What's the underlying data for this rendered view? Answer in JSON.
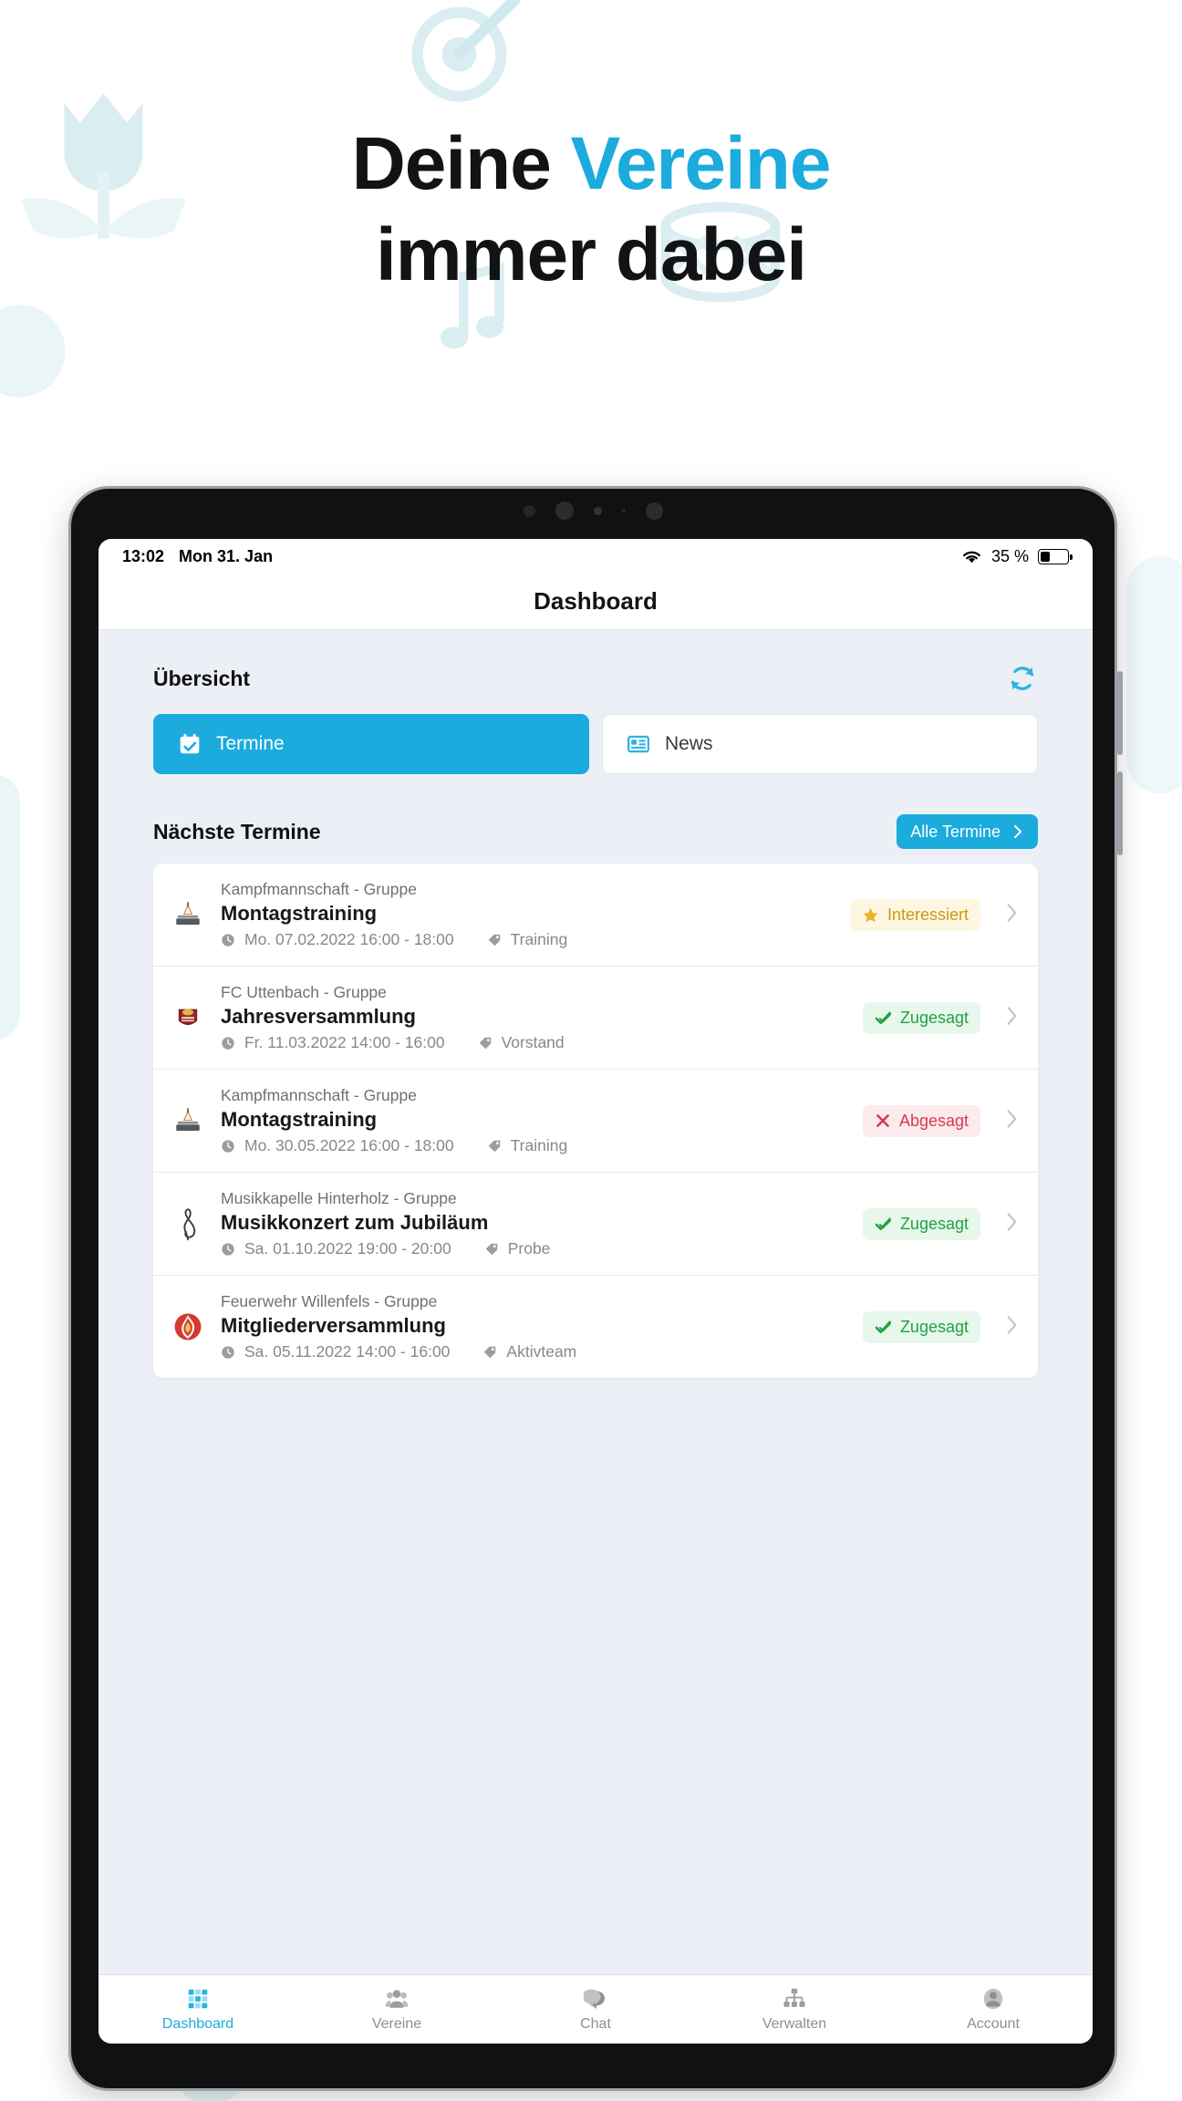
{
  "hero": {
    "line1_pre": "Deine ",
    "line1_accent": "Vereine",
    "line2": "immer dabei",
    "accent_color": "#1BABDD"
  },
  "device": {
    "statusbar": {
      "time": "13:02",
      "date": "Mon 31. Jan",
      "battery_percent": "35 %",
      "wifi_icon": "wifi-icon",
      "battery_icon": "battery-icon"
    },
    "appbar": {
      "title": "Dashboard"
    }
  },
  "overview": {
    "title": "Übersicht",
    "refresh_icon": "refresh-icon",
    "tabs": [
      {
        "label": "Termine",
        "icon": "calendar-icon",
        "active": true
      },
      {
        "label": "News",
        "icon": "news-icon",
        "active": false
      }
    ]
  },
  "next_appointments": {
    "title": "Nächste Termine",
    "all_button": {
      "label": "Alle Termine",
      "icon": "chevron-right-icon"
    },
    "events": [
      {
        "group": "Kampfmannschaft - Gruppe",
        "title": "Montagstraining",
        "datetime": "Mo. 07.02.2022 16:00 - 18:00",
        "tag": "Training",
        "status": "Interessiert",
        "status_kind": "interessiert",
        "status_icon": "star-icon",
        "logo": "club-crest-icon"
      },
      {
        "group": "FC Uttenbach - Gruppe",
        "title": "Jahresversammlung",
        "datetime": "Fr. 11.03.2022 14:00 - 16:00",
        "tag": "Vorstand",
        "status": "Zugesagt",
        "status_kind": "zugesagt",
        "status_icon": "check-icon",
        "logo": "football-crest-icon"
      },
      {
        "group": "Kampfmannschaft - Gruppe",
        "title": "Montagstraining",
        "datetime": "Mo. 30.05.2022 16:00 - 18:00",
        "tag": "Training",
        "status": "Abgesagt",
        "status_kind": "abgesagt",
        "status_icon": "cross-icon",
        "logo": "club-crest-icon"
      },
      {
        "group": "Musikkapelle Hinterholz - Gruppe",
        "title": "Musikkonzert zum Jubiläum",
        "datetime": "Sa. 01.10.2022 19:00 - 20:00",
        "tag": "Probe",
        "status": "Zugesagt",
        "status_kind": "zugesagt",
        "status_icon": "check-icon",
        "logo": "treble-clef-icon"
      },
      {
        "group": "Feuerwehr Willenfels - Gruppe",
        "title": "Mitgliederversammlung",
        "datetime": "Sa. 05.11.2022 14:00 - 16:00",
        "tag": "Aktivteam",
        "status": "Zugesagt",
        "status_kind": "zugesagt",
        "status_icon": "check-icon",
        "logo": "fire-flame-icon"
      }
    ],
    "clock_icon": "clock-icon",
    "tag_icon": "tag-icon",
    "row_chevron": "chevron-right-icon"
  },
  "bottom_nav": [
    {
      "label": "Dashboard",
      "icon": "grid-icon",
      "active": true
    },
    {
      "label": "Vereine",
      "icon": "people-icon",
      "active": false
    },
    {
      "label": "Chat",
      "icon": "chat-icon",
      "active": false
    },
    {
      "label": "Verwalten",
      "icon": "sitemap-icon",
      "active": false
    },
    {
      "label": "Account",
      "icon": "account-icon",
      "active": false
    }
  ],
  "decor": {
    "color_light": "#daeef2",
    "color_lighter": "#e9f5f7",
    "icons": [
      "tulip-icon",
      "target-icon",
      "drum-icon",
      "music-note-icon",
      "trumpet-icon",
      "axe-icon",
      "circle-icon"
    ]
  }
}
